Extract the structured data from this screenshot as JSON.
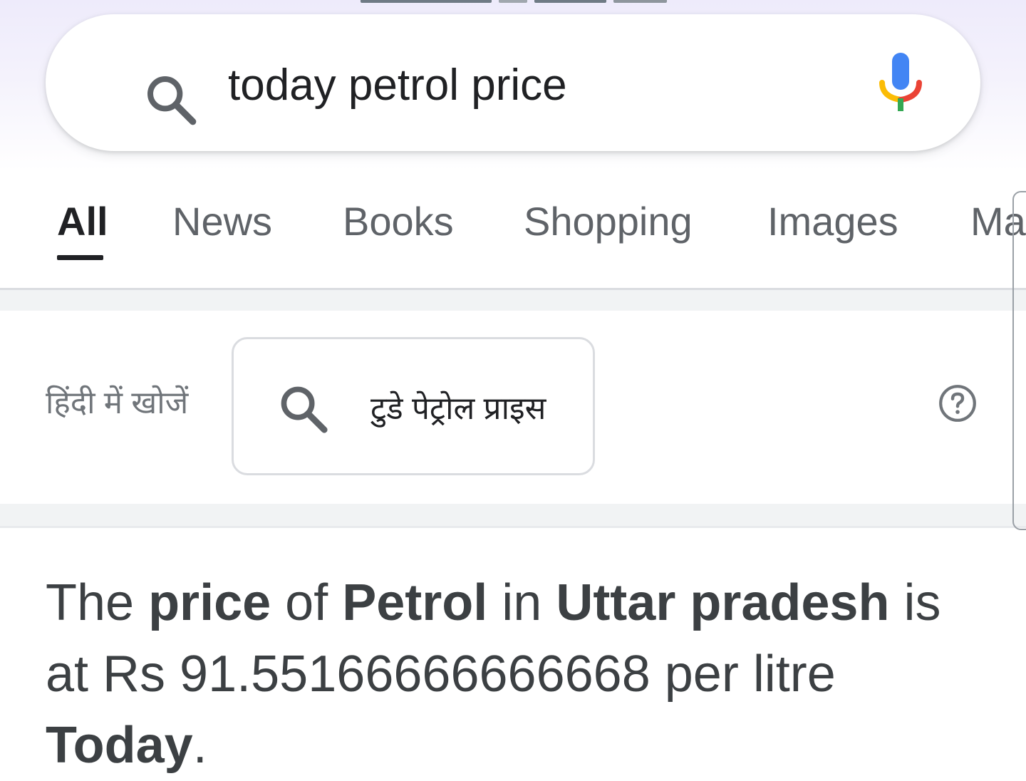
{
  "search": {
    "query": "today petrol price"
  },
  "tabs": [
    {
      "label": "All",
      "active": true
    },
    {
      "label": "News",
      "active": false
    },
    {
      "label": "Books",
      "active": false
    },
    {
      "label": "Shopping",
      "active": false
    },
    {
      "label": "Images",
      "active": false
    },
    {
      "label": "Ma",
      "active": false
    }
  ],
  "hindi_suggestion": {
    "label": "हिंदी में खोजें",
    "query": "टुडे पेट्रोल प्राइस"
  },
  "answer": {
    "parts": [
      {
        "text": "The ",
        "bold": false
      },
      {
        "text": "price",
        "bold": true
      },
      {
        "text": " of ",
        "bold": false
      },
      {
        "text": "Petrol",
        "bold": true
      },
      {
        "text": " in ",
        "bold": false
      },
      {
        "text": "Uttar pradesh",
        "bold": true
      },
      {
        "text": " is at Rs 91.55166666666668 per litre ",
        "bold": false
      },
      {
        "text": "Today",
        "bold": true
      },
      {
        "text": ".",
        "bold": false
      }
    ]
  },
  "icons": {
    "search": "search-icon",
    "mic": "mic-icon",
    "help": "help-icon"
  },
  "colors": {
    "mic_blue": "#4285F4",
    "mic_red": "#EA4335",
    "mic_yellow": "#FBBC05",
    "mic_green": "#34A853",
    "active_tab": "#202124",
    "inactive_tab": "#5f6368"
  }
}
